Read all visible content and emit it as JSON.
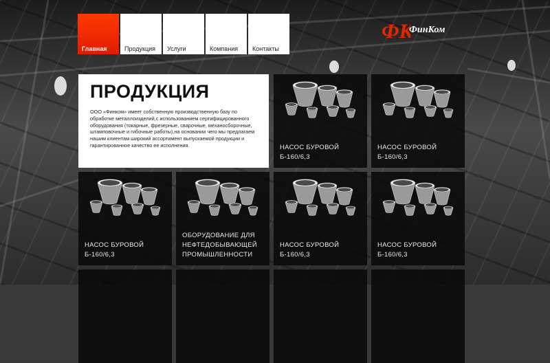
{
  "nav": [
    {
      "label": "Главная",
      "active": true
    },
    {
      "label": "Продукция",
      "active": false
    },
    {
      "label": "Услуги",
      "active": false
    },
    {
      "label": "Компания",
      "active": false
    },
    {
      "label": "Контакты",
      "active": false
    }
  ],
  "logo": {
    "mark": "ФК",
    "text": "ФинКом"
  },
  "intro": {
    "title": "ПРОДУКЦИЯ",
    "text": "ООО «Финком» имеет собственную производственную базу по обработке металлоизделий,с использованием сертифицированного оборудования (токарные, фрезерные, сварочные, механосборочные, штамповочные и гибочные работы),на основании чего мы предлагаем нашим клиентам широкий ассортимент выпускаемой продукции и гарантированное качество ее исполнения."
  },
  "cards": [
    {
      "line1": "НАСОС БУРОВОЙ",
      "line2": "Б-160/6,3",
      "line3": ""
    },
    {
      "line1": "НАСОС БУРОВОЙ",
      "line2": "Б-160/6,3",
      "line3": ""
    },
    {
      "line1": "НАСОС БУРОВОЙ",
      "line2": "Б-160/6,3",
      "line3": ""
    },
    {
      "line1": "ОБОРУДОВАНИЕ ДЛЯ",
      "line2": "НЕФТЕДОБЫВАЮЩЕЙ",
      "line3": "ПРОМЫШЛЕННОСТИ"
    },
    {
      "line1": "НАСОС БУРОВОЙ",
      "line2": "Б-160/6,3",
      "line3": ""
    },
    {
      "line1": "НАСОС БУРОВОЙ",
      "line2": "Б-160/6,3",
      "line3": ""
    }
  ],
  "colors": {
    "accent": "#e82400",
    "card_bg": "#0a0a0a",
    "intro_bg": "#ffffff"
  }
}
